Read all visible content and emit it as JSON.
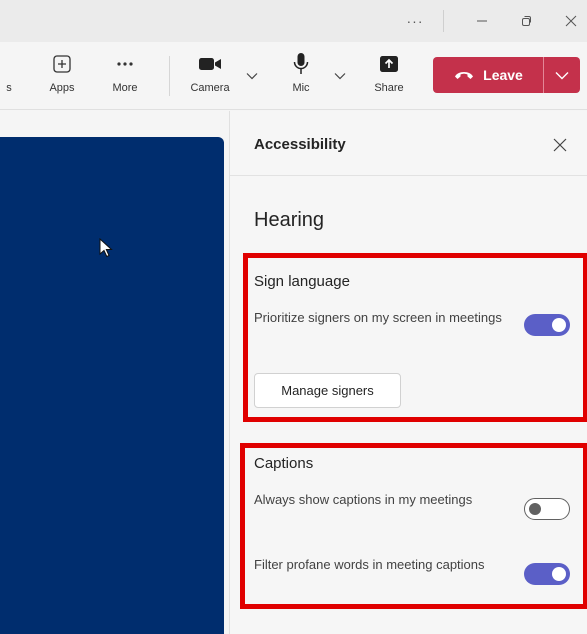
{
  "titlebar": {
    "more_label": "···",
    "icons": [
      "more-horizontal-icon",
      "minimize-icon",
      "restore-icon",
      "close-icon"
    ]
  },
  "toolbar": {
    "partial_label": "s",
    "apps_label": "Apps",
    "more_label": "More",
    "camera_label": "Camera",
    "mic_label": "Mic",
    "share_label": "Share",
    "leave_label": "Leave",
    "leave_color": "#c4314b"
  },
  "stage": {
    "background": "#002d6e"
  },
  "panel": {
    "title": "Accessibility",
    "section_title": "Hearing",
    "sign_language": {
      "title": "Sign language",
      "prioritize_label": "Prioritize signers on my screen in meetings",
      "prioritize_on": true,
      "manage_button": "Manage signers"
    },
    "captions": {
      "title": "Captions",
      "always_show_label": "Always show captions in my meetings",
      "always_show_on": false,
      "filter_label": "Filter profane words in meeting captions",
      "filter_on": true
    }
  },
  "colors": {
    "accent": "#5b5fc7",
    "highlight": "#e00000"
  }
}
